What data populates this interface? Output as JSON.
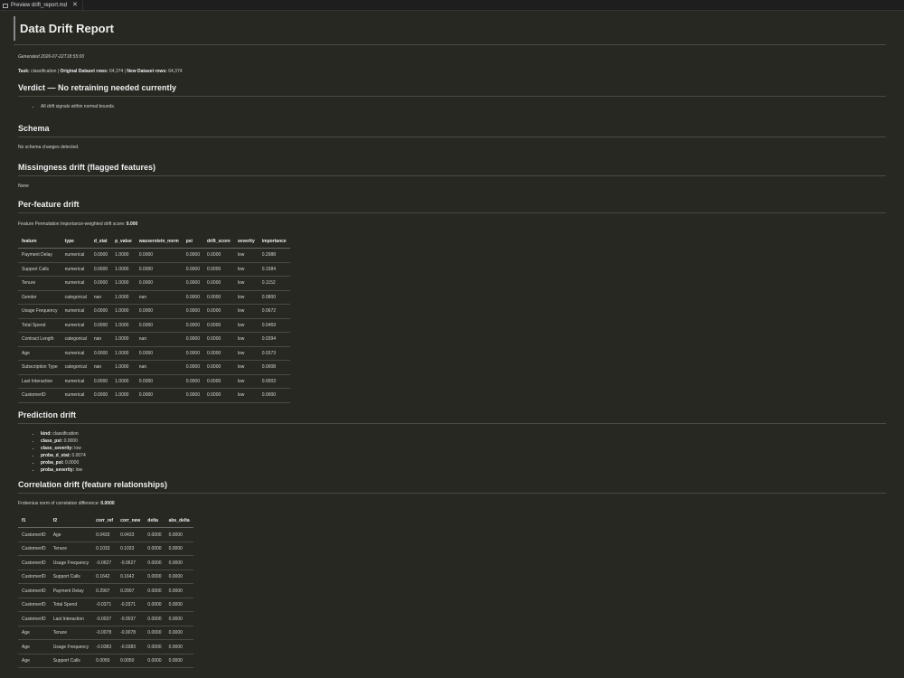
{
  "tab": {
    "label": "Preview drift_report.md"
  },
  "title": "Data Drift Report",
  "generated": "Generated 2026-07-22T18:55:00",
  "task": {
    "task_label": "Task:",
    "task_value": "classification",
    "orig_label": "Original Dataset rows:",
    "orig_value": "64,374",
    "new_label": "New Dataset rows:",
    "new_value": "64,374"
  },
  "verdict": {
    "heading": "Verdict — No retraining needed currently",
    "items": [
      "All drift signals within normal bounds."
    ]
  },
  "schema": {
    "heading": "Schema",
    "text": "No schema changes detected."
  },
  "missingness": {
    "heading": "Missingness drift (flagged features)",
    "text": "None"
  },
  "per_feature": {
    "heading": "Per-feature drift",
    "score_label": "Feature Permutation Importance-weighted drift score:",
    "score_value": "0.000",
    "columns": [
      "feature",
      "type",
      "d_stat",
      "p_value",
      "wasserstein_norm",
      "psi",
      "drift_score",
      "severity",
      "importance"
    ],
    "rows": [
      [
        "Payment Delay",
        "numerical",
        "0.0000",
        "1.0000",
        "0.0000",
        "0.0000",
        "0.0000",
        "low",
        "0.2988"
      ],
      [
        "Support Calls",
        "numerical",
        "0.0000",
        "1.0000",
        "0.0000",
        "0.0000",
        "0.0000",
        "low",
        "0.1584"
      ],
      [
        "Tenure",
        "numerical",
        "0.0000",
        "1.0000",
        "0.0000",
        "0.0000",
        "0.0000",
        "low",
        "0.1152"
      ],
      [
        "Gender",
        "categorical",
        "nan",
        "1.0000",
        "nan",
        "0.0000",
        "0.0000",
        "low",
        "0.0800"
      ],
      [
        "Usage Frequency",
        "numerical",
        "0.0000",
        "1.0000",
        "0.0000",
        "0.0000",
        "0.0000",
        "low",
        "0.0672"
      ],
      [
        "Total Spend",
        "numerical",
        "0.0000",
        "1.0000",
        "0.0000",
        "0.0000",
        "0.0000",
        "low",
        "0.0469"
      ],
      [
        "Contract Length",
        "categorical",
        "nan",
        "1.0000",
        "nan",
        "0.0000",
        "0.0000",
        "low",
        "0.0394"
      ],
      [
        "Age",
        "numerical",
        "0.0000",
        "1.0000",
        "0.0000",
        "0.0000",
        "0.0000",
        "low",
        "0.0373"
      ],
      [
        "Subscription Type",
        "categorical",
        "nan",
        "1.0000",
        "nan",
        "0.0000",
        "0.0000",
        "low",
        "0.0008"
      ],
      [
        "Last Interaction",
        "numerical",
        "0.0000",
        "1.0000",
        "0.0000",
        "0.0000",
        "0.0000",
        "low",
        "0.0003"
      ],
      [
        "CustomerID",
        "numerical",
        "0.0000",
        "1.0000",
        "0.0000",
        "0.0000",
        "0.0000",
        "low",
        "0.0000"
      ]
    ]
  },
  "prediction": {
    "heading": "Prediction drift",
    "items": [
      {
        "key": "kind:",
        "value": "classification"
      },
      {
        "key": "class_psi:",
        "value": "0.0000"
      },
      {
        "key": "class_severity:",
        "value": "low"
      },
      {
        "key": "proba_d_stat:",
        "value": "0.0074"
      },
      {
        "key": "proba_psi:",
        "value": "0.0000"
      },
      {
        "key": "proba_severity:",
        "value": "low"
      }
    ]
  },
  "correlation": {
    "heading": "Correlation drift (feature relationships)",
    "norm_label": "Frobenius norm of correlation difference:",
    "norm_value": "0.0000",
    "columns": [
      "f1",
      "f2",
      "corr_ref",
      "corr_new",
      "delta",
      "abs_delta"
    ],
    "rows": [
      [
        "CustomerID",
        "Age",
        "0.0433",
        "0.0433",
        "0.0000",
        "0.0000"
      ],
      [
        "CustomerID",
        "Tenure",
        "0.1033",
        "0.1033",
        "0.0000",
        "0.0000"
      ],
      [
        "CustomerID",
        "Usage Frequency",
        "-0.0627",
        "-0.0627",
        "0.0000",
        "0.0000"
      ],
      [
        "CustomerID",
        "Support Calls",
        "0.1642",
        "0.1642",
        "0.0000",
        "0.0000"
      ],
      [
        "CustomerID",
        "Payment Delay",
        "0.2907",
        "0.2907",
        "0.0000",
        "0.0000"
      ],
      [
        "CustomerID",
        "Total Spend",
        "-0.0371",
        "-0.0371",
        "0.0000",
        "0.0000"
      ],
      [
        "CustomerID",
        "Last Interaction",
        "-0.0037",
        "-0.0037",
        "0.0000",
        "0.0000"
      ],
      [
        "Age",
        "Tenure",
        "-0.0078",
        "-0.0078",
        "0.0000",
        "0.0000"
      ],
      [
        "Age",
        "Usage Frequency",
        "-0.0383",
        "-0.0383",
        "0.0000",
        "0.0000"
      ],
      [
        "Age",
        "Support Calls",
        "0.0050",
        "0.0050",
        "0.0000",
        "0.0000"
      ]
    ]
  }
}
